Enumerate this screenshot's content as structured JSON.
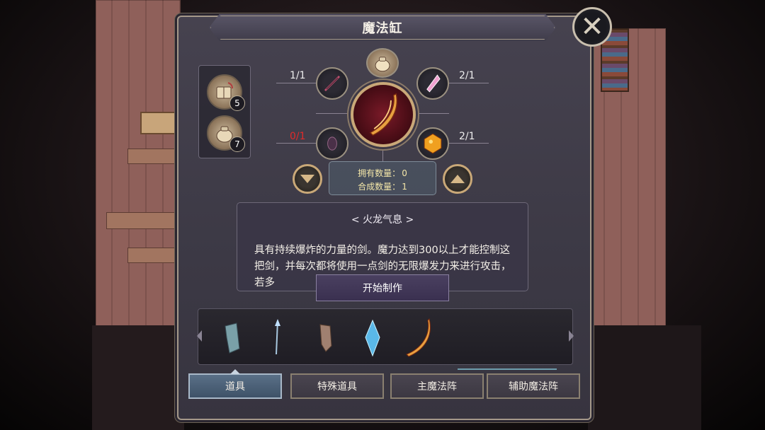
{
  "panel": {
    "title": "魔法缸"
  },
  "close": {
    "icon": "close-icon"
  },
  "inventory": [
    {
      "name": "grimoire-pouch",
      "icon": "bag-book-icon",
      "count": "5"
    },
    {
      "name": "cloth-pouch",
      "icon": "pouch-icon",
      "count": "7"
    }
  ],
  "recipe": {
    "top_ingredient_icon": "pouch-icon",
    "ingredients": [
      {
        "position": "top-left",
        "icon": "dark-blade-icon",
        "ratio": "1/1",
        "sufficient": true
      },
      {
        "position": "top-right",
        "icon": "crystal-shard-icon",
        "ratio": "2/1",
        "sufficient": true
      },
      {
        "position": "bottom-left",
        "icon": "dark-gem-icon",
        "ratio": "0/1",
        "sufficient": false
      },
      {
        "position": "bottom-right",
        "icon": "fire-ore-icon",
        "ratio": "2/1",
        "sufficient": true
      }
    ],
    "result_icon": "flame-sword-icon",
    "owned_label": "拥有数量：",
    "owned_value": "0",
    "craft_label": "合成数量：",
    "craft_value": "1"
  },
  "description": {
    "title": "< 火龙气息 >",
    "text": "具有持续爆炸的力量的剑。魔力达到300以上才能控制这把剑，并每次都将使用一点剑的无限爆发力来进行攻击，若多后，……………………………………………………………………………………………………………………………………………………………………………………………………………………"
  },
  "start_button": {
    "label": "开始制作"
  },
  "strip_items": [
    {
      "icon": "stone-shard-icon"
    },
    {
      "icon": "ice-wand-icon"
    },
    {
      "icon": "rock-fragment-icon"
    },
    {
      "icon": "blue-crystal-icon"
    },
    {
      "icon": "flame-sword-icon"
    }
  ],
  "tabs": [
    {
      "label": "道具",
      "active": true
    },
    {
      "label": "特殊道具",
      "active": false
    },
    {
      "label": "主魔法阵",
      "active": false
    },
    {
      "label": "辅助魔法阵",
      "active": false
    }
  ],
  "colors": {
    "accent_gold": "#c9a878",
    "warn_red": "#e02a2a",
    "count_text": "#f3e6a8",
    "active_tab": "#5a7088"
  }
}
